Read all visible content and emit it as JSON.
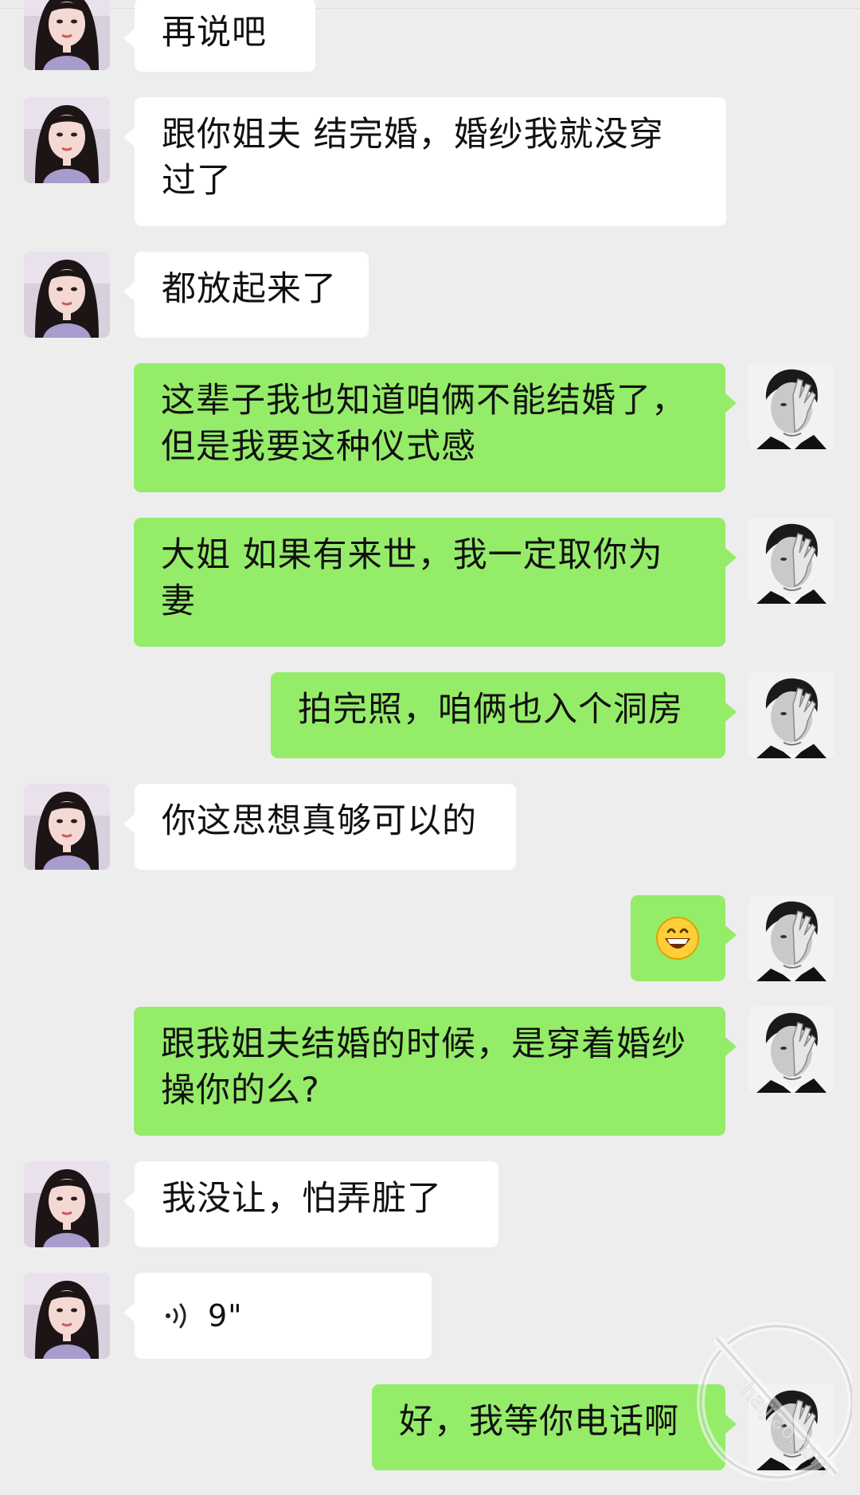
{
  "conversation": {
    "messages": [
      {
        "side": "left",
        "text": "再说吧"
      },
      {
        "side": "left",
        "text": "跟你姐夫 结完婚，婚纱我就没穿过了"
      },
      {
        "side": "left",
        "text": "都放起来了"
      },
      {
        "side": "right",
        "text": "这辈子我也知道咱俩不能结婚了，但是我要这种仪式感"
      },
      {
        "side": "right",
        "text": "大姐 如果有来世，我一定取你为妻"
      },
      {
        "side": "right",
        "text": "拍完照，咱俩也入个洞房"
      },
      {
        "side": "left",
        "text": "你这思想真够可以的"
      },
      {
        "side": "right",
        "emoji": "grinning-face-emoji"
      },
      {
        "side": "right",
        "text": "跟我姐夫结婚的时候，是穿着婚纱操你的么?"
      },
      {
        "side": "left",
        "text": "我没让，怕弄脏了"
      },
      {
        "side": "left",
        "voice_duration": "9\""
      },
      {
        "side": "right",
        "text": "好，我等你电话啊"
      }
    ]
  },
  "msg0_line1": "再说吧",
  "msg1_line1": "跟你姐夫 结完婚，婚纱我就没穿",
  "msg1_line2": "过了",
  "msg2_line1": "都放起来了",
  "msg3_line1": "这辈子我也知道咱俩不能结婚了，",
  "msg3_line2": "但是我要这种仪式感",
  "msg4_line1": "大姐 如果有来世，我一定取你为",
  "msg4_line2": "妻",
  "msg5_line1": "拍完照，咱俩也入个洞房",
  "msg6_line1": "你这思想真够可以的",
  "msg8_line1": "跟我姐夫结婚的时候，是穿着婚纱",
  "msg8_line2": "操你的么?",
  "msg9_line1": "我没让，怕弄脏了",
  "msg10_voice": "9\"",
  "msg11_line1": "好，我等你电话啊",
  "watermark_text": "haijiao.com",
  "colors": {
    "background": "#ededed",
    "left_bubble": "#ffffff",
    "right_bubble": "#95ec69",
    "text": "#111111"
  },
  "icons": {
    "left_avatar": "woman-avatar",
    "right_avatar": "man-avatar",
    "voice": "voice-wave-icon",
    "emoji": "grinning-face-emoji"
  }
}
